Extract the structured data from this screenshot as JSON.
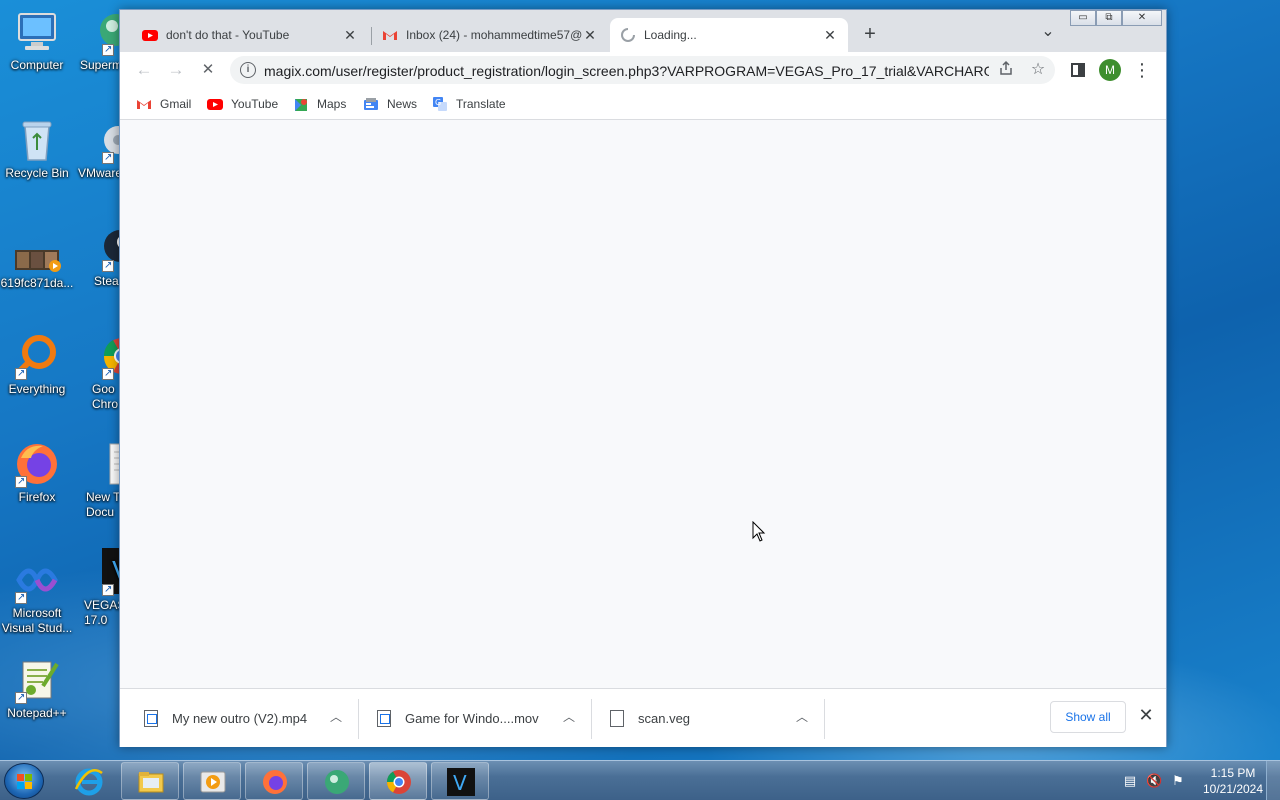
{
  "desktop": {
    "icons": [
      {
        "label": "Computer",
        "icon": "computer-icon"
      },
      {
        "label": "Superm",
        "icon": "superm-icon"
      },
      {
        "label": "Recycle Bin",
        "icon": "recycle-bin-icon"
      },
      {
        "label": "VMware",
        "icon": "vmware-icon"
      },
      {
        "label": "619fc871da...",
        "icon": "video-file-icon"
      },
      {
        "label": "Stea",
        "icon": "steam-icon"
      },
      {
        "label": "Everything",
        "icon": "everything-search-icon"
      },
      {
        "label": "Goo\nChro",
        "icon": "chrome-icon"
      },
      {
        "label": "Firefox",
        "icon": "firefox-icon"
      },
      {
        "label": "New T\nDocu",
        "icon": "text-document-icon"
      },
      {
        "label": "Microsoft\nVisual Stud...",
        "icon": "visual-studio-icon"
      },
      {
        "label": "VEGAS\n17.0",
        "icon": "vegas-icon"
      },
      {
        "label": "Notepad++",
        "icon": "notepadpp-icon"
      }
    ]
  },
  "browser": {
    "tabs": [
      {
        "title": "don't do that - YouTube",
        "icon": "youtube-icon"
      },
      {
        "title": "Inbox (24) - mohammedtime57@",
        "icon": "gmail-icon"
      },
      {
        "title": "Loading...",
        "icon": "loading-spinner-icon"
      }
    ],
    "new_tab": "+",
    "tab_search": "⌄",
    "window_controls": {
      "minimize": "▭",
      "restore": "⧉",
      "close": "✕"
    },
    "toolbar": {
      "back": "←",
      "forward": "→",
      "stop": "✕",
      "url": "magix.com/user/register/product_registration/login_screen.php3?VARPROGRAM=VEGAS_Pro_17_trial&VARCHARGE...",
      "profile_initial": "M",
      "menu": "⋮"
    },
    "bookmarks": [
      {
        "label": "Gmail",
        "icon": "gmail-icon"
      },
      {
        "label": "YouTube",
        "icon": "youtube-icon"
      },
      {
        "label": "Maps",
        "icon": "maps-icon"
      },
      {
        "label": "News",
        "icon": "news-icon"
      },
      {
        "label": "Translate",
        "icon": "translate-icon"
      }
    ],
    "downloads": [
      {
        "name": "My new outro (V2).mp4",
        "icon": "video-file-icon"
      },
      {
        "name": "Game for Windo....mov",
        "icon": "video-file-icon"
      },
      {
        "name": "scan.veg",
        "icon": "file-icon"
      }
    ],
    "show_all": "Show all",
    "download_close": "✕"
  },
  "taskbar": {
    "apps": [
      "explorer-icon",
      "media-player-icon",
      "firefox-icon",
      "vmware-icon",
      "chrome-icon",
      "vegas-icon"
    ],
    "clock_time": "1:15 PM",
    "clock_date": "10/21/2024"
  },
  "colors": {
    "accent": "#1a73e8",
    "youtube_red": "#ff0000",
    "profile_green": "#3e8e2e"
  }
}
